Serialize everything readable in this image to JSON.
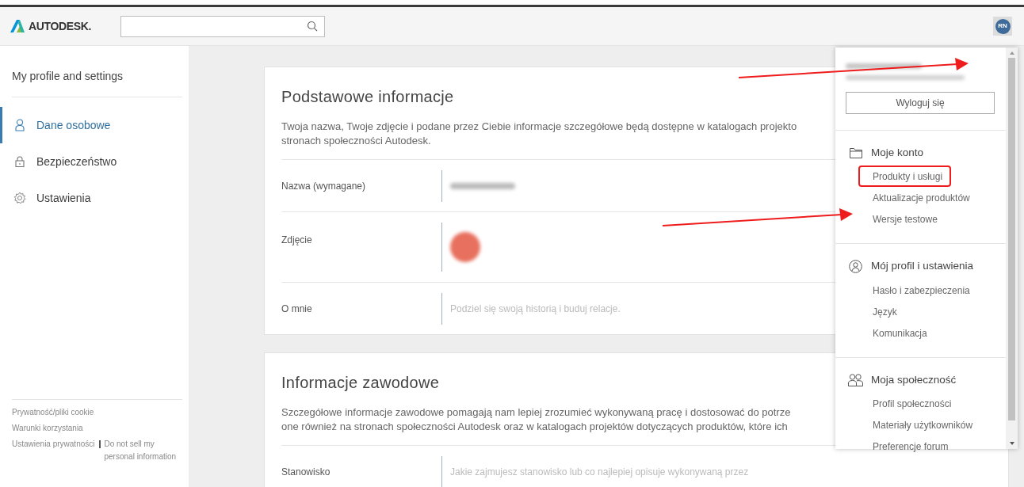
{
  "header": {
    "logo": "AUTODESK.",
    "avatar": "RN"
  },
  "sidebar": {
    "title": "My profile and settings",
    "items": [
      {
        "label": "Dane osobowe",
        "selected": true
      },
      {
        "label": "Bezpieczeństwo",
        "selected": false
      },
      {
        "label": "Ustawienia",
        "selected": false
      }
    ],
    "footer_lines": [
      [
        "Prywatność/pliki cookie"
      ],
      [
        "Warunki korzystania"
      ],
      [
        "Ustawienia prywatności",
        "Do not sell my personal information"
      ]
    ]
  },
  "cards": [
    {
      "title": "Podstawowe informacje",
      "description_lines": [
        "Twoja nazwa, Twoje zdjęcie i podane przez Ciebie informacje szczegółowe będą dostępne w katalogach projekto",
        "stronach społeczności Autodesk."
      ],
      "rows": [
        {
          "label": "Nazwa (wymagane)",
          "kind": "redacted"
        },
        {
          "label": "Zdjęcie",
          "kind": "photo"
        },
        {
          "label": "O mnie",
          "kind": "placeholder",
          "placeholder": "Podziel się swoją historią i buduj relacje."
        }
      ]
    },
    {
      "title": "Informacje zawodowe",
      "description_lines": [
        "Szczegółowe informacje zawodowe pomagają nam lepiej zrozumieć wykonywaną pracę i dostosować do potrze",
        "one również na stronach społeczności Autodesk oraz w katalogach projektów dotyczących produktów, które ich"
      ],
      "rows": [
        {
          "label": "Stanowisko",
          "kind": "placeholder",
          "placeholder": "Jakie zajmujesz stanowisko lub co najlepiej opisuje wykonywaną przez"
        }
      ]
    }
  ],
  "account_menu": {
    "sign_out": "Wyloguj się",
    "sections": [
      {
        "heading": "Moje konto",
        "items": [
          {
            "label": "Produkty i usługi",
            "highlighted": true
          },
          {
            "label": "Aktualizacje produktów",
            "highlighted": false
          },
          {
            "label": "Wersje testowe",
            "highlighted": false
          }
        ]
      },
      {
        "heading": "Mój profil i ustawienia",
        "items": [
          {
            "label": "Hasło i zabezpieczenia",
            "highlighted": false
          },
          {
            "label": "Język",
            "highlighted": false
          },
          {
            "label": "Komunikacja",
            "highlighted": false
          }
        ]
      },
      {
        "heading": "Moja społeczność",
        "items": [
          {
            "label": "Profil społeczności",
            "highlighted": false
          },
          {
            "label": "Materiały użytkowników",
            "highlighted": false
          },
          {
            "label": "Preferencje forum",
            "highlighted": false
          }
        ]
      }
    ]
  }
}
